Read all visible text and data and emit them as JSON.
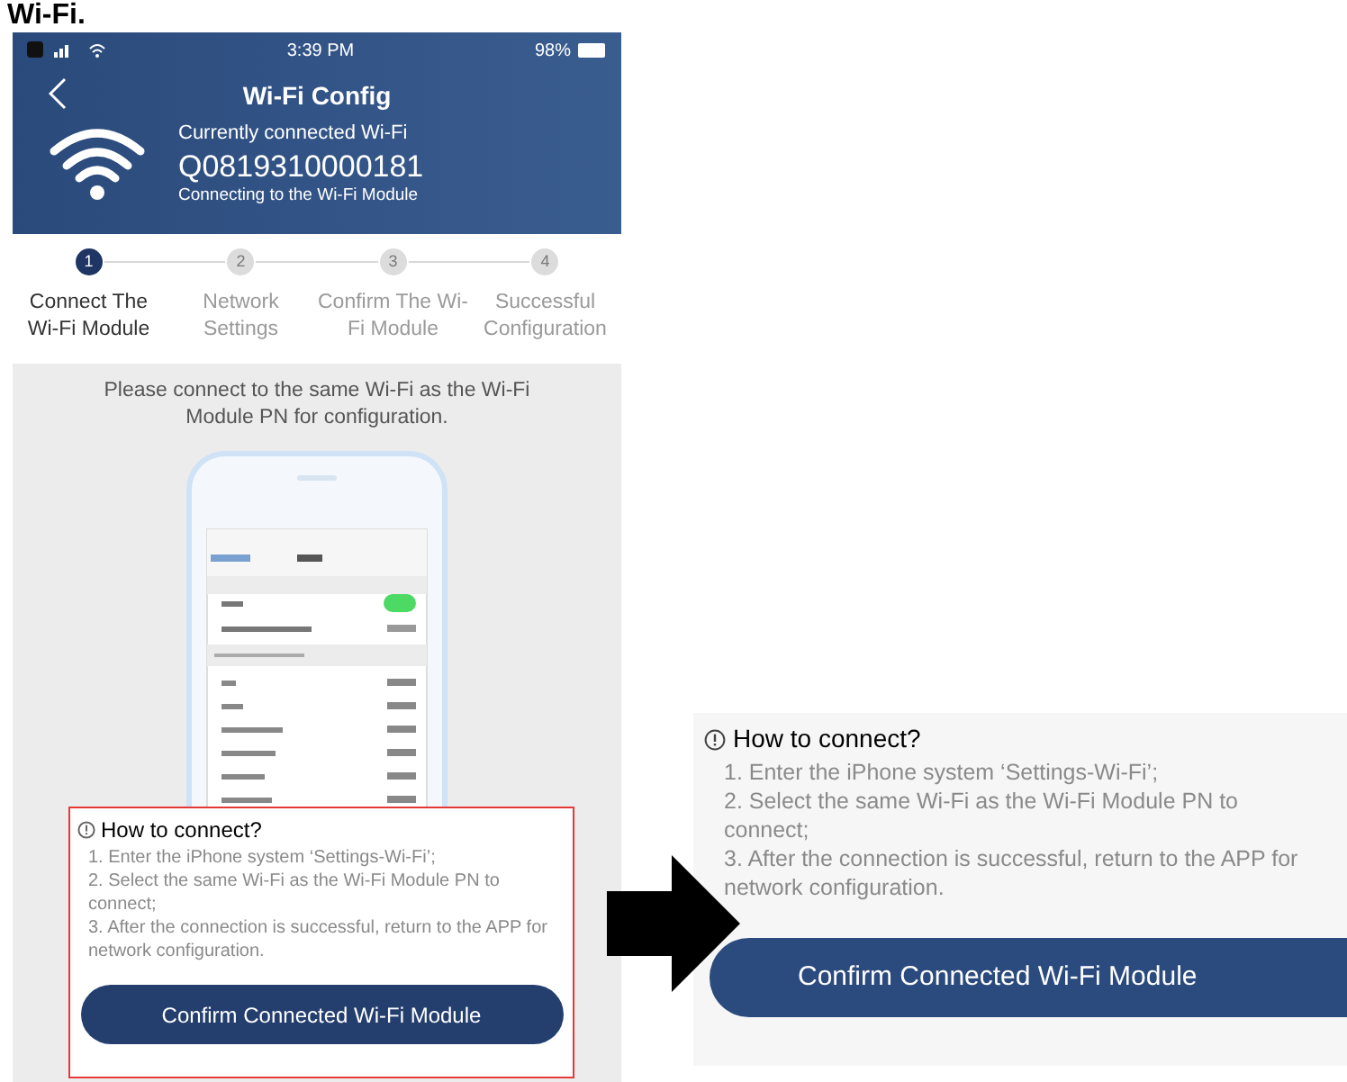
{
  "heading": "Wi-Fi.",
  "phone": {
    "status_bar": {
      "time": "3:39 PM",
      "battery": "98%"
    },
    "title": "Wi-Fi Config",
    "connection": {
      "caption": "Currently connected Wi-Fi",
      "ssid": "Q0819310000181",
      "status": "Connecting to the Wi-Fi Module"
    },
    "steps": [
      {
        "number": "1",
        "label": "Connect The Wi-Fi Module",
        "selected": true
      },
      {
        "number": "2",
        "label": "Network Settings",
        "selected": false
      },
      {
        "number": "3",
        "label": "Confirm The Wi-Fi Module",
        "selected": false
      },
      {
        "number": "4",
        "label": "Successful Configuration",
        "selected": false
      }
    ],
    "instruction": "Please connect to the same Wi-Fi as the Wi-Fi Module PN for configuration.",
    "help": {
      "title": "How to connect?",
      "lines": [
        "1. Enter the iPhone system ‘Settings-Wi-Fi’;",
        "2. Select the same Wi-Fi as the Wi-Fi Module PN to connect;",
        "3. After the connection is successful, return to the APP for network configuration."
      ]
    },
    "button": "Confirm Connected Wi-Fi Module"
  },
  "zoomed_help": {
    "title": "How to connect?",
    "lines": [
      "1. Enter the iPhone system ‘Settings-Wi-Fi’;",
      "2. Select the same Wi-Fi as the Wi-Fi Module PN to connect;",
      "3. After the connection is successful, return to the APP for network configuration."
    ],
    "button": "Confirm Connected Wi-Fi Module"
  }
}
